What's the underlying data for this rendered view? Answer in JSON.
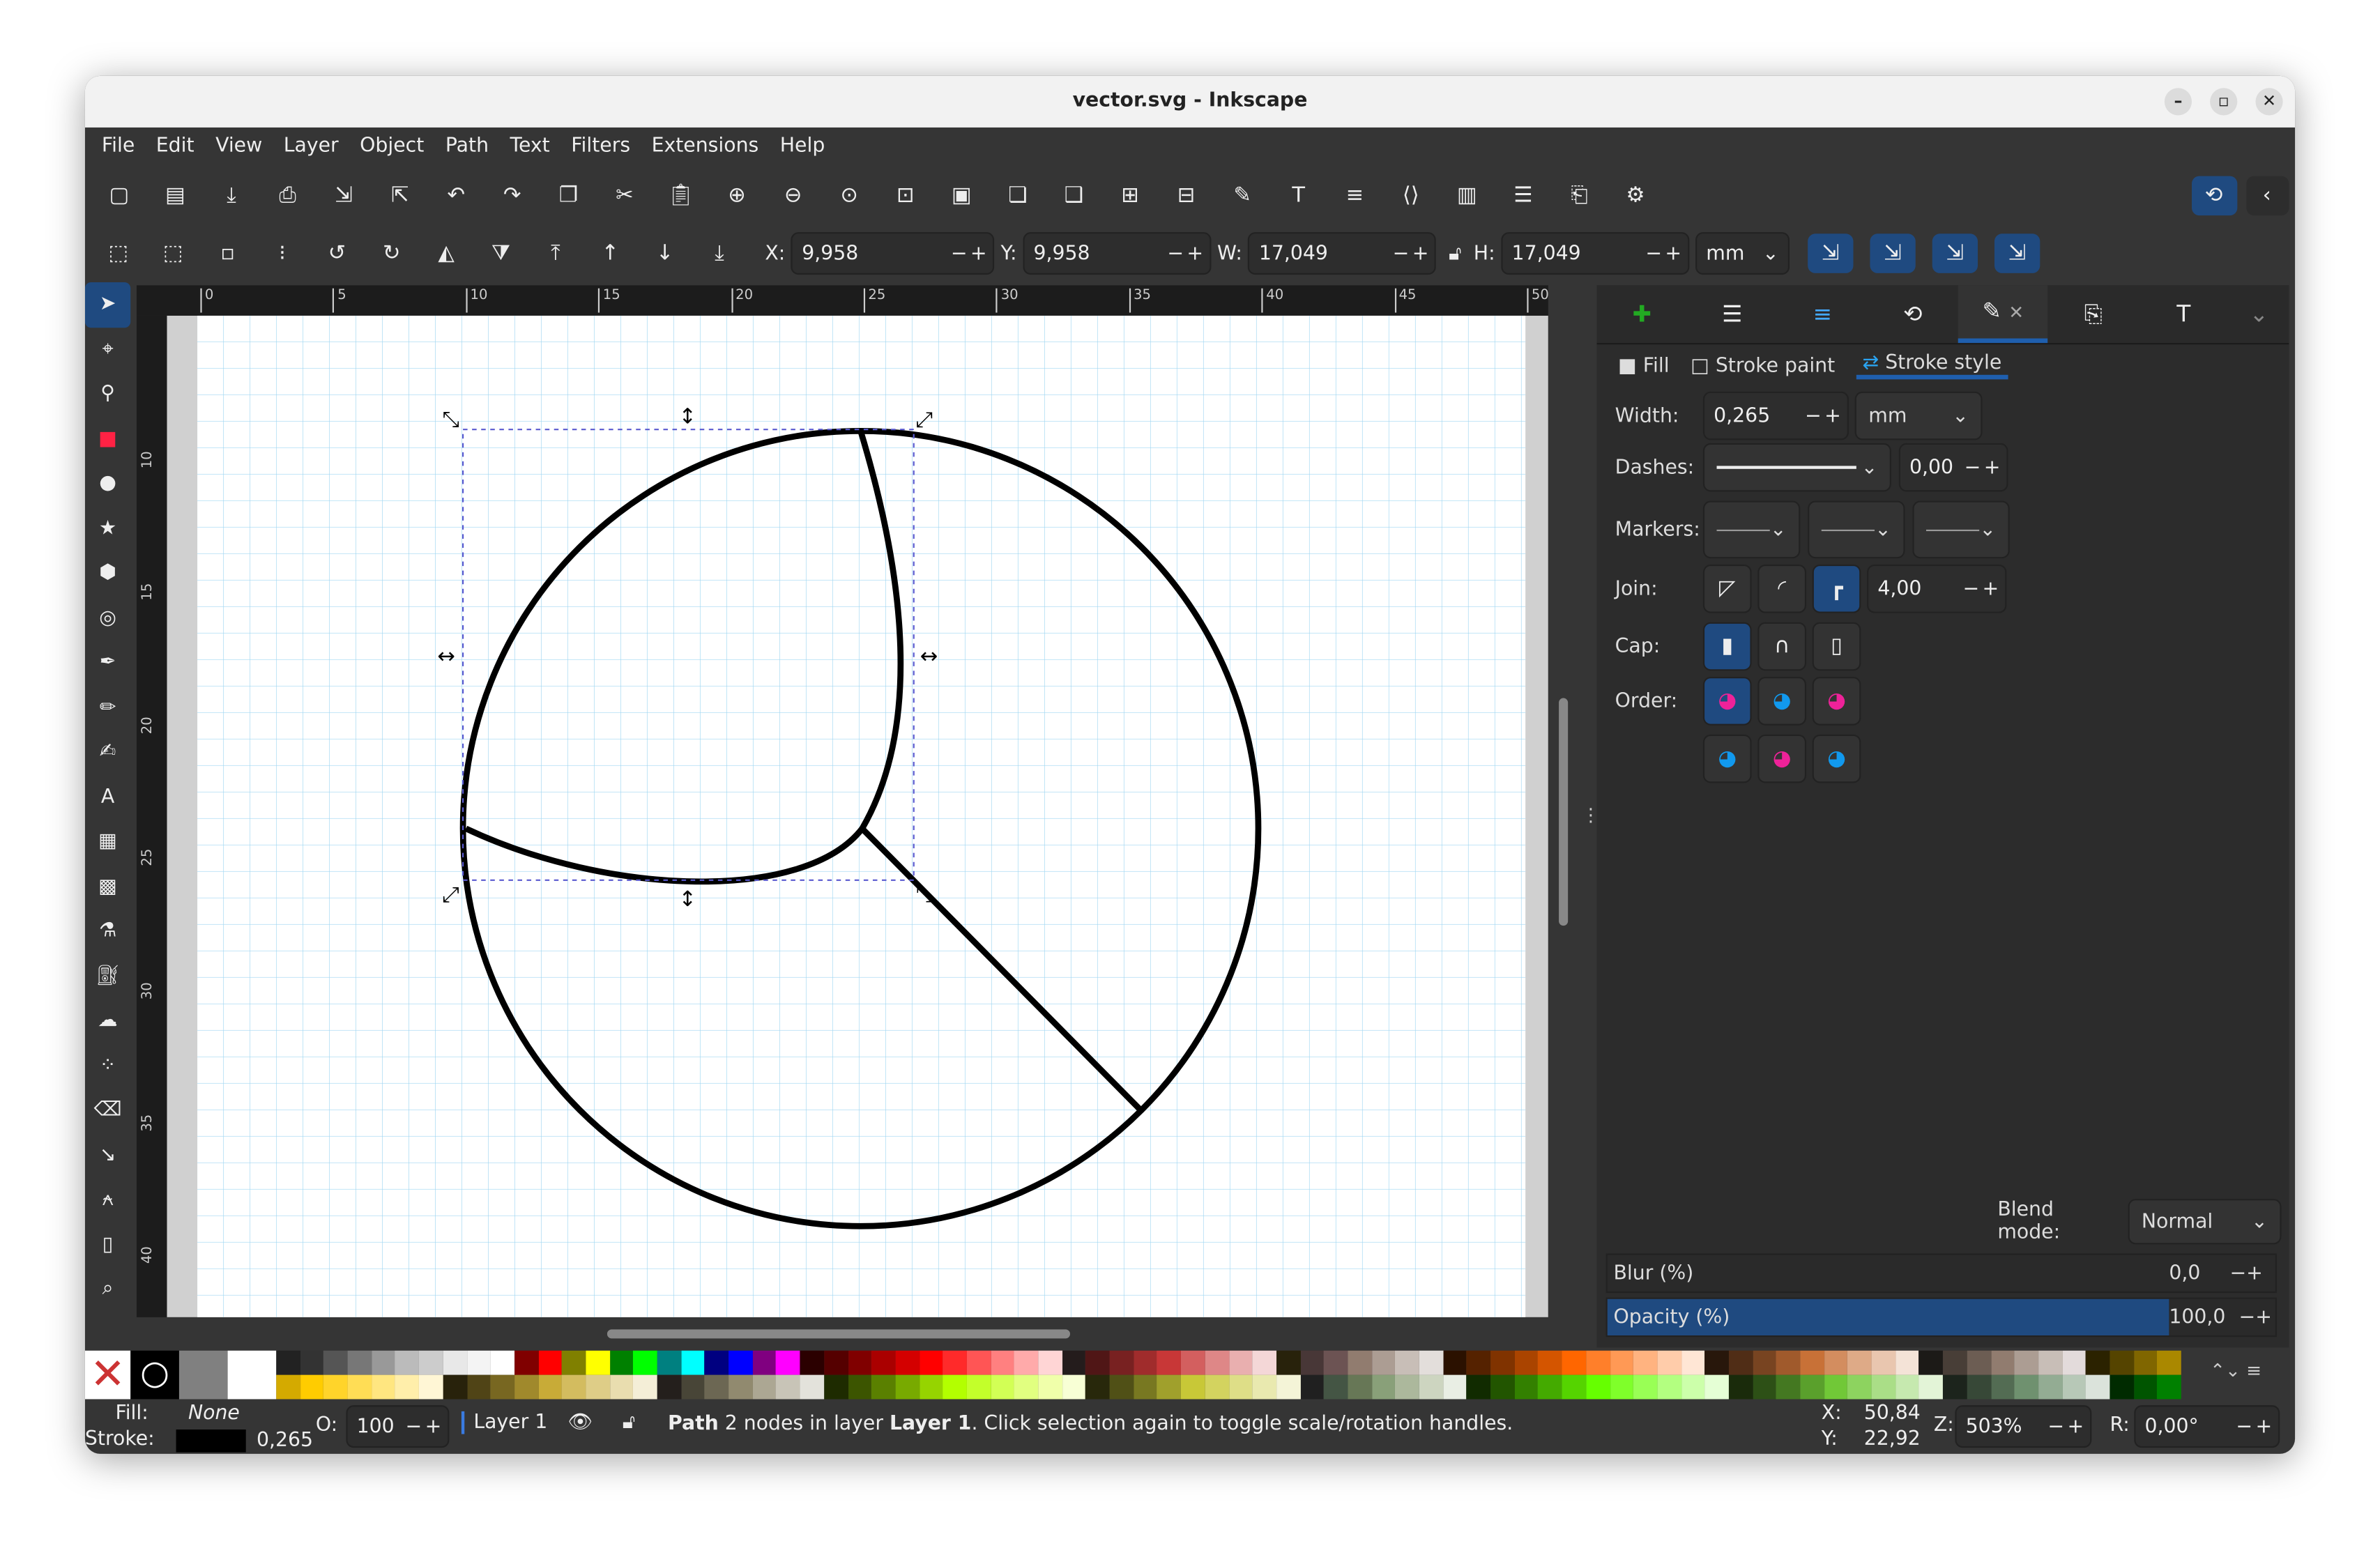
{
  "window": {
    "title": "vector.svg - Inkscape"
  },
  "menu": [
    "File",
    "Edit",
    "View",
    "Layer",
    "Object",
    "Path",
    "Text",
    "Filters",
    "Extensions",
    "Help"
  ],
  "toolbar1_icons": [
    "new-document-icon",
    "open-icon",
    "save-icon",
    "print-icon",
    "import-icon",
    "export-icon",
    "undo-icon",
    "redo-icon",
    "copy-icon",
    "cut-icon",
    "paste-icon",
    "zoom-selection-icon",
    "zoom-drawing-icon",
    "zoom-page-icon",
    "zoom-fit-icon",
    "duplicate-icon",
    "clone-icon",
    "unlink-clone-icon",
    "group-icon",
    "ungroup-icon",
    "fill-stroke-icon",
    "text-font-icon",
    "layers-icon",
    "xml-editor-icon",
    "swatches-icon",
    "align-icon",
    "document-properties-icon",
    "preferences-icon"
  ],
  "toolbar2_icons": [
    "select-all-icon",
    "select-all-layers-icon",
    "deselect-icon",
    "select-same-icon",
    "rotate-ccw-icon",
    "rotate-cw-icon",
    "flip-horizontal-icon",
    "flip-vertical-icon",
    "raise-to-top-icon",
    "raise-icon",
    "lower-icon",
    "lower-to-bottom-icon"
  ],
  "transform": {
    "x_label": "X:",
    "x": "9,958",
    "y_label": "Y:",
    "y": "9,958",
    "w_label": "W:",
    "w": "17,049",
    "h_label": "H:",
    "h": "17,049",
    "unit": "mm"
  },
  "tools": [
    "selector-tool-icon",
    "node-tool-icon",
    "tweak-tool-icon",
    "rectangle-tool-icon",
    "ellipse-tool-icon",
    "star-tool-icon",
    "3dbox-tool-icon",
    "spiral-tool-icon",
    "pen-tool-icon",
    "pencil-tool-icon",
    "calligraphy-tool-icon",
    "text-tool-icon",
    "gradient-tool-icon",
    "mesh-tool-icon",
    "dropper-tool-icon",
    "paint-bucket-tool-icon",
    "tweak-brush-icon",
    "spray-tool-icon",
    "eraser-tool-icon",
    "connector-tool-icon",
    "lpe-tool-icon",
    "pages-tool-icon",
    "zoom-tool-icon"
  ],
  "ruler_top": [
    "0",
    "5",
    "10",
    "15",
    "20",
    "25",
    "30",
    "35",
    "40",
    "45",
    "50"
  ],
  "ruler_left": [
    "10",
    "15",
    "20",
    "25",
    "30",
    "35",
    "40"
  ],
  "panel": {
    "subtabs": {
      "fill": "Fill",
      "stroke_paint": "Stroke paint",
      "stroke_style": "Stroke style"
    },
    "width_label": "Width:",
    "width": "0,265",
    "width_unit": "mm",
    "dashes_label": "Dashes:",
    "dash_offset": "0,00",
    "markers_label": "Markers:",
    "join_label": "Join:",
    "miter": "4,00",
    "cap_label": "Cap:",
    "order_label": "Order:",
    "blend_label": "Blend mode:",
    "blend": "Normal",
    "blur_label": "Blur (%)",
    "blur": "0,0",
    "opacity_label": "Opacity (%)",
    "opacity": "100,0",
    "opacity_value": 100
  },
  "palette_top": [
    "#222",
    "#333",
    "#555",
    "#777",
    "#999",
    "#bbb",
    "#ccc",
    "#e8e8e8",
    "#f4f4f4",
    "#fff",
    "#800000",
    "#ff0000",
    "#808000",
    "#ffff00",
    "#008000",
    "#00ff00",
    "#008080",
    "#00ffff",
    "#000080",
    "#0000ff",
    "#800080",
    "#ff00ff",
    "#2b0000",
    "#550000",
    "#800000",
    "#aa0000",
    "#d40000",
    "#ff0000",
    "#ff2a2a",
    "#ff5555",
    "#ff8080",
    "#ffaaaa",
    "#ffd5d5",
    "#241c1c",
    "#501616",
    "#782121",
    "#a02c2c",
    "#c83737",
    "#d35f5f",
    "#de8787",
    "#e9afaf",
    "#f4d7d7",
    "#28220b",
    "#483737",
    "#6c5353",
    "#917c6f",
    "#ac9d93",
    "#c8beb7",
    "#e3dedb",
    "#2b1100",
    "#552200",
    "#803300",
    "#aa4400",
    "#d45500",
    "#ff6600",
    "#ff7f2a",
    "#ff9955",
    "#ffb380",
    "#ffccaa",
    "#ffe6d5",
    "#28170b",
    "#502d16",
    "#784421",
    "#a05a2c",
    "#c87137",
    "#d38d5f",
    "#deaa87",
    "#e9c6af",
    "#f4e3d7",
    "#1c1a17",
    "#483e37",
    "#6c5d53",
    "#917c6f",
    "#ac9d93",
    "#c8beb7",
    "#e3dbdb",
    "#2b2200",
    "#554400",
    "#806600",
    "#aa8800"
  ],
  "palette_bottom": [
    "#d4aa00",
    "#ffcc00",
    "#ffd42a",
    "#ffdd55",
    "#ffe680",
    "#ffeeaa",
    "#fff6d5",
    "#28220b",
    "#504416",
    "#786721",
    "#a0892c",
    "#c8ab37",
    "#d3bc5f",
    "#decd87",
    "#e9ddaf",
    "#f4eed7",
    "#241f1c",
    "#484537",
    "#6c6753",
    "#918a6f",
    "#aca793",
    "#c8c4b7",
    "#e3e2db",
    "#1e2b00",
    "#3c5500",
    "#5a8000",
    "#78aa00",
    "#96d400",
    "#b3ff00",
    "#c3ff2a",
    "#d2ff55",
    "#e1ff80",
    "#f0ffaa",
    "#f8ffd5",
    "#28280b",
    "#505016",
    "#787821",
    "#a0a02c",
    "#c8c837",
    "#d3d35f",
    "#dede87",
    "#e9e9af",
    "#f4f4d7",
    "#202020",
    "#445544",
    "#677756",
    "#89a079",
    "#acb89c",
    "#cdd5c0",
    "#e9eee4",
    "#112b00",
    "#225500",
    "#338000",
    "#44aa00",
    "#55d400",
    "#66ff00",
    "#7fff2a",
    "#99ff55",
    "#b3ff80",
    "#ccffaa",
    "#e5ffd5",
    "#1a2b0b",
    "#2d5016",
    "#447821",
    "#5aa02c",
    "#71c837",
    "#8dd35f",
    "#aade87",
    "#c6e9af",
    "#e3f4d7",
    "#1c241c",
    "#374837",
    "#536c53",
    "#6f916f",
    "#93ac93",
    "#b7c8b7",
    "#dbe3db",
    "#002b00",
    "#005500",
    "#008000",
    "#00aa00"
  ],
  "status": {
    "fill_label": "Fill:",
    "fill": "None",
    "stroke_label": "Stroke:",
    "stroke_width": "0,265",
    "opacity_label": "O:",
    "opacity": "100",
    "layer": "Layer 1",
    "msg_bold1": "Path",
    "msg1": " 2 nodes in layer ",
    "msg_bold2": "Layer 1",
    "msg2": ". Click selection again to toggle scale/rotation handles.",
    "x_label": "X:",
    "x": "50,84",
    "y_label": "Y:",
    "y": "22,92",
    "zoom_label": "Z:",
    "zoom": "503%",
    "rot_label": "R:",
    "rotation": "0,00°"
  }
}
